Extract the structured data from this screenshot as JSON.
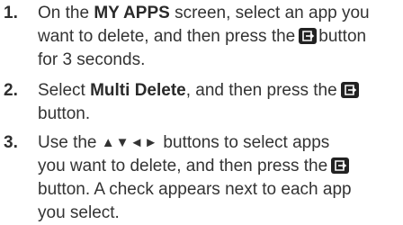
{
  "steps": [
    {
      "number": "1.",
      "line1_pre": "On the ",
      "line1_bold": "MY APPS",
      "line1_post": " screen, select an app you",
      "line2_pre": "want to delete, and then press the",
      "line2_post": "button",
      "line3": "for 3 seconds.",
      "icon": "enter-button-icon"
    },
    {
      "number": "2.",
      "line1_pre": "Select ",
      "line1_bold": "Multi Delete",
      "line1_post": ", and then press the",
      "line2": "button.",
      "icon": "enter-button-icon"
    },
    {
      "number": "3.",
      "line1_pre": "Use the ",
      "arrows": "▲▼◄►",
      "line1_post": " buttons to select apps",
      "line2_pre": "you want to delete, and then press the",
      "line3": "button. A check appears next to each app",
      "line4": "you select.",
      "icon": "enter-button-icon"
    }
  ],
  "colors": {
    "text": "#333333",
    "icon": "#222222"
  }
}
